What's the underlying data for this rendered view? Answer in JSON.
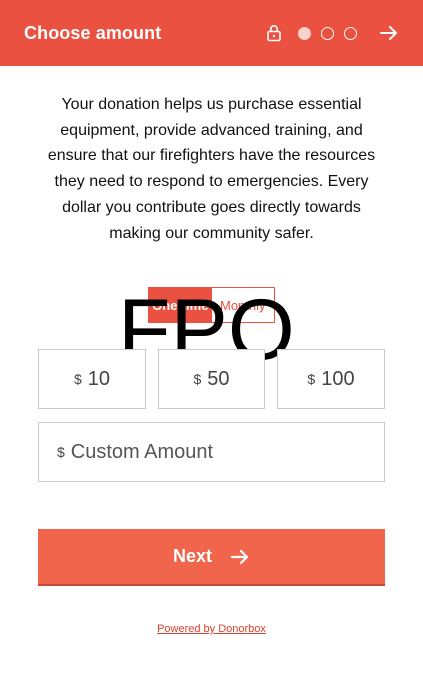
{
  "header": {
    "title": "Choose amount",
    "lock_icon": "lock-icon",
    "steps": [
      {
        "state": "active"
      },
      {
        "state": "inactive"
      },
      {
        "state": "inactive"
      }
    ],
    "next_icon": "arrow-right-icon"
  },
  "description": "Your donation helps us purchase essential equipment, provide advanced training, and ensure that our firefighters have the resources they need to respond to emergencies. Every dollar you contribute goes directly towards making our community safer.",
  "frequency": {
    "options": [
      {
        "label": "One-time",
        "selected": true
      },
      {
        "label": "Monthly",
        "selected": false
      }
    ]
  },
  "overlay_text": "FPO",
  "amounts": [
    {
      "currency": "$",
      "value": "10"
    },
    {
      "currency": "$",
      "value": "50"
    },
    {
      "currency": "$",
      "value": "100"
    }
  ],
  "custom_amount": {
    "currency": "$",
    "placeholder": "Custom Amount"
  },
  "next_button": {
    "label": "Next",
    "icon": "arrow-right-icon"
  },
  "footer": {
    "powered_by": "Powered by Donorbox"
  },
  "colors": {
    "brand": "#ea5140",
    "button": "#f0654b"
  }
}
